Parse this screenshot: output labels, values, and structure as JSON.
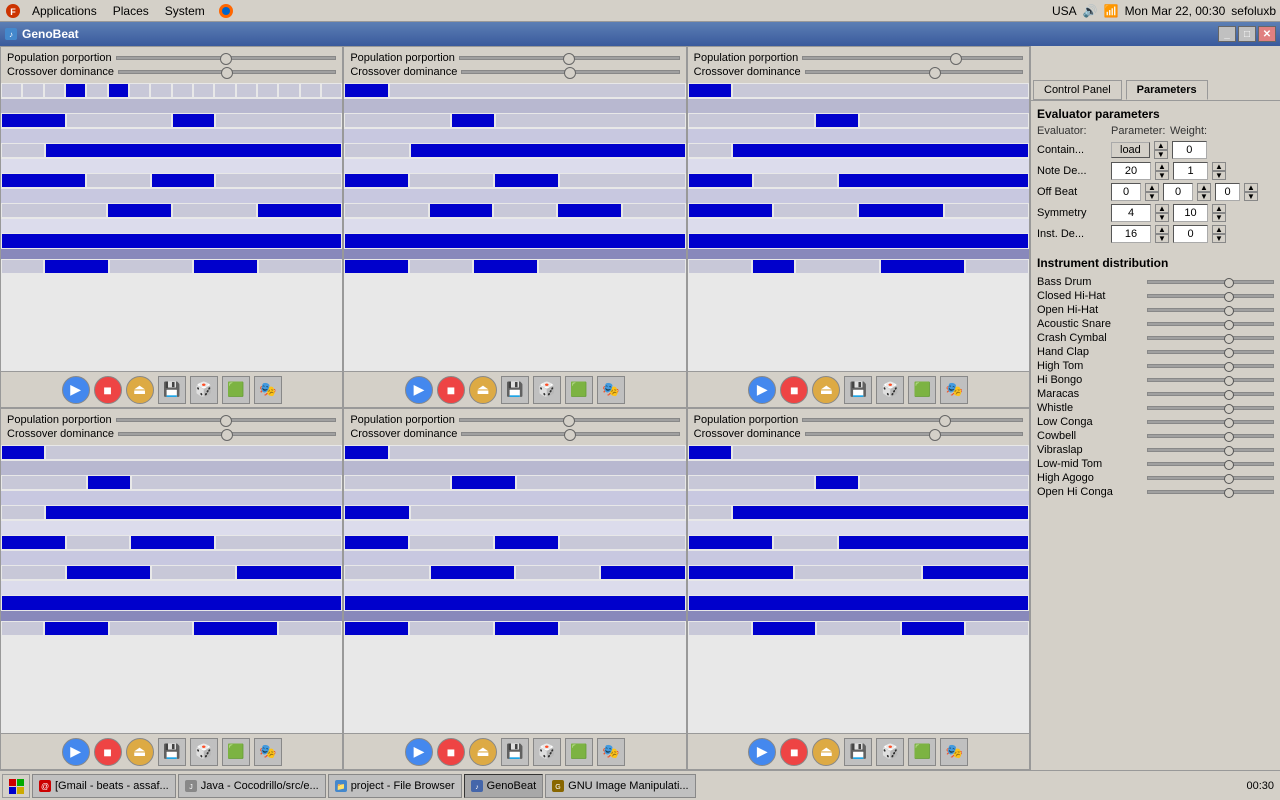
{
  "menubar": {
    "items": [
      "Applications",
      "Places",
      "System"
    ],
    "systray": {
      "locale": "USA",
      "datetime": "Mon Mar 22, 00:30",
      "username": "sefoluxb"
    }
  },
  "titlebar": {
    "title": "GenoBeat",
    "icon": "music-icon",
    "controls": [
      "minimize",
      "maximize",
      "close"
    ]
  },
  "grid": {
    "sliders": {
      "population": "Population porportion",
      "crossover": "Crossover dominance"
    }
  },
  "right_panel": {
    "tabs": [
      "Control Panel",
      "Parameters"
    ],
    "active_tab": "Parameters",
    "evaluator_params": {
      "title": "Evaluator parameters",
      "headers": [
        "Evaluator:",
        "Parameter:",
        "Weight:"
      ],
      "rows": [
        {
          "label": "Contain...",
          "param_type": "load",
          "param_value": "load",
          "weight": "0"
        },
        {
          "label": "Note De...",
          "param_value": "20",
          "weight": "1"
        },
        {
          "label": "Off Beat",
          "param_value1": "0",
          "param_value2": "0",
          "weight": "0"
        },
        {
          "label": "Symmetry",
          "param_value": "4",
          "weight": "10"
        },
        {
          "label": "Inst. De...",
          "param_value": "16",
          "weight": "0"
        }
      ]
    },
    "instrument_distribution": {
      "title": "Instrument distribution",
      "instruments": [
        "Bass Drum",
        "Closed Hi-Hat",
        "Open Hi-Hat",
        "Acoustic Snare",
        "Crash Cymbal",
        "Hand Clap",
        "High Tom",
        "Hi Bongo",
        "Maracas",
        "Whistle",
        "Low Conga",
        "Cowbell",
        "Vibraslap",
        "Low-mid Tom",
        "High Agogo",
        "Open Hi Conga"
      ]
    }
  },
  "toolbar_buttons": [
    "play",
    "stop",
    "eject",
    "save",
    "dice1",
    "pattern",
    "tool"
  ],
  "taskbar": {
    "items": [
      {
        "label": "[Gmail - beats - assaf...",
        "active": false
      },
      {
        "label": "Java - Cocodrillo/src/e...",
        "active": false
      },
      {
        "label": "project - File Browser",
        "active": false
      },
      {
        "label": "GenoBeat",
        "active": true
      },
      {
        "label": "GNU Image Manipulati...",
        "active": false
      }
    ]
  }
}
